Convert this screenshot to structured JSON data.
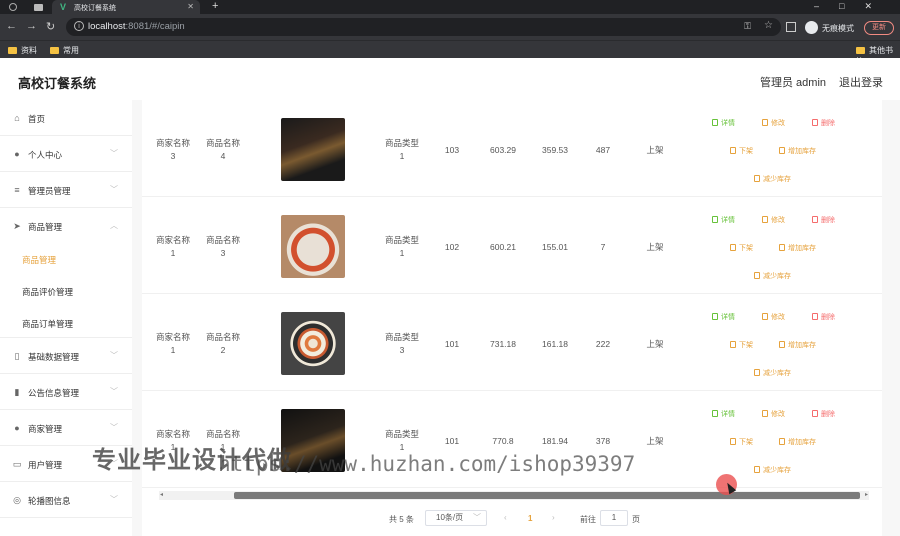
{
  "browser": {
    "tab_title": "高校订餐系统",
    "url_host": "localhost",
    "url_rest": ":8081/#/caipin",
    "incognito_label": "无痕模式",
    "update_label": "更新",
    "bookmarks": [
      "资料",
      "常用"
    ],
    "bookmarks_right": "其他书签"
  },
  "header": {
    "title": "高校订餐系统",
    "admin_label": "管理员 admin",
    "logout_label": "退出登录"
  },
  "sidebar": {
    "items": [
      {
        "label": "首页",
        "icon": "home-icon"
      },
      {
        "label": "个人中心",
        "icon": "user-icon"
      },
      {
        "label": "管理员管理",
        "icon": "list-icon"
      },
      {
        "label": "商品管理",
        "icon": "send-icon"
      },
      {
        "label": "基础数据管理",
        "icon": "phone-icon"
      },
      {
        "label": "公告信息管理",
        "icon": "bar-chart-icon"
      },
      {
        "label": "商家管理",
        "icon": "pin-icon"
      },
      {
        "label": "用户管理",
        "icon": "window-icon"
      },
      {
        "label": "轮播图信息",
        "icon": "compass-icon"
      }
    ],
    "subitems": [
      {
        "label": "商品管理",
        "active": true
      },
      {
        "label": "商品评价管理",
        "active": false
      },
      {
        "label": "商品订单管理",
        "active": false
      }
    ]
  },
  "table": {
    "rows": [
      {
        "merchant": [
          "商家名称",
          "3"
        ],
        "product": [
          "商品名称",
          "4"
        ],
        "type": [
          "商品类型",
          "1"
        ],
        "col_a": "103",
        "col_b": "603.29",
        "col_c": "359.53",
        "col_d": "487",
        "status": "上架"
      },
      {
        "merchant": [
          "商家名称",
          "1"
        ],
        "product": [
          "商品名称",
          "3"
        ],
        "type": [
          "商品类型",
          "1"
        ],
        "col_a": "102",
        "col_b": "600.21",
        "col_c": "155.01",
        "col_d": "7",
        "status": "上架"
      },
      {
        "merchant": [
          "商家名称",
          "1"
        ],
        "product": [
          "商品名称",
          "2"
        ],
        "type": [
          "商品类型",
          "3"
        ],
        "col_a": "101",
        "col_b": "731.18",
        "col_c": "161.18",
        "col_d": "222",
        "status": "上架"
      },
      {
        "merchant": [
          "商家名称",
          "1"
        ],
        "product": [
          "商品名称",
          "1"
        ],
        "type": [
          "商品类型",
          "1"
        ],
        "col_a": "101",
        "col_b": "770.8",
        "col_c": "181.94",
        "col_d": "378",
        "status": "上架"
      }
    ],
    "actions": {
      "detail": "详情",
      "edit": "修改",
      "delete": "删除",
      "offshelf": "下架",
      "add_stock": "增加库存",
      "reduce_stock": "减少库存"
    }
  },
  "pagination": {
    "total": "共 5 条",
    "page_size": "10条/页",
    "current_page": "1",
    "goto_label": "前往",
    "goto_value": "1",
    "page_unit": "页"
  },
  "watermark": {
    "line1": "专业毕业设计代做",
    "line2": "https://www.huzhan.com/ishop39397"
  },
  "colors": {
    "accent": "#e6a23c",
    "detail": "#67c23a",
    "delete": "#f56c6c"
  }
}
